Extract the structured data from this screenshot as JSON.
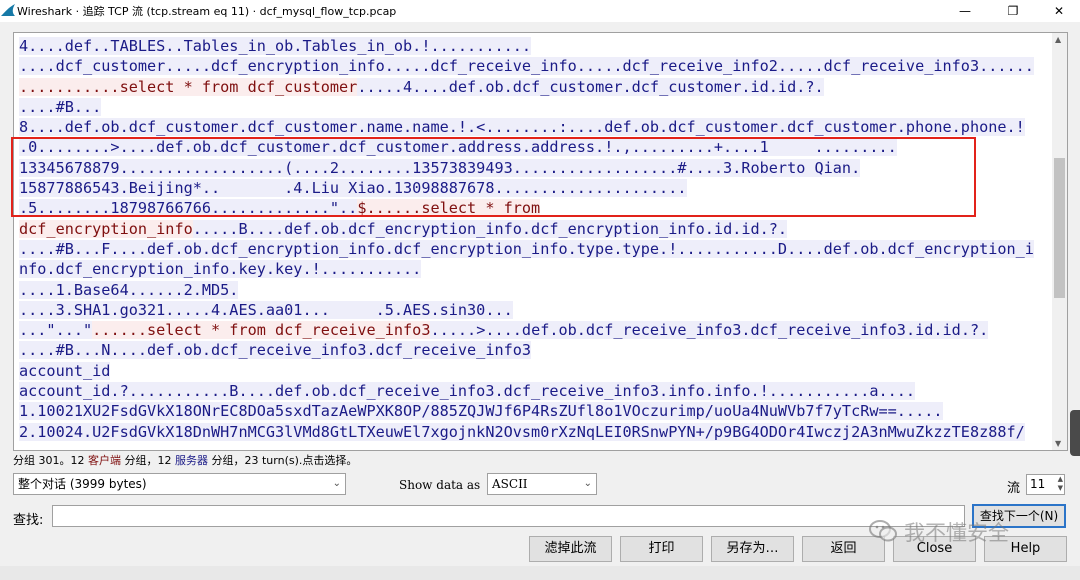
{
  "window": {
    "title": "Wireshark · 追踪 TCP 流 (tcp.stream eq 11) · dcf_mysql_flow_tcp.pcap",
    "controls": [
      "—",
      "❐",
      "✕"
    ]
  },
  "stream_lines": [
    [
      {
        "t": "4....def..TABLES..Tables_in_ob.Tables_in_ob.!...........",
        "k": "s"
      }
    ],
    [
      {
        "t": "....dcf_customer.....dcf_encryption_info.....dcf_receive_info.....dcf_receive_info2.....dcf_receive_info3......",
        "k": "s"
      }
    ],
    [
      {
        "t": "...........select * from dcf_customer",
        "k": "c"
      },
      {
        "t": ".....4....def.ob.dcf_customer.dcf_customer.id.id.?.",
        "k": "s"
      }
    ],
    [
      {
        "t": "....#B...",
        "k": "s"
      }
    ],
    [
      {
        "t": "8....def.ob.dcf_customer.dcf_customer.name.name.!.<........:....def.ob.dcf_customer.dcf_customer.phone.phone.!",
        "k": "s"
      }
    ],
    [
      {
        "t": ".0........>....def.ob.dcf_customer.dcf_customer.address.address.!.,.........+....1     .........",
        "k": "s"
      }
    ],
    [
      {
        "t": "13345678879..................(....2........13573839493..................#....3.Roberto Qian.",
        "k": "s"
      }
    ],
    [
      {
        "t": "15877886543.Beijing*..       .4.Liu Xiao.13098887678.....................",
        "k": "s"
      }
    ],
    [
      {
        "t": ".5........18798766766.............\"..",
        "k": "s"
      },
      {
        "t": "$......select * from",
        "k": "c"
      }
    ],
    [
      {
        "t": "dcf_encryption_info",
        "k": "c"
      },
      {
        "t": ".....B....def.ob.dcf_encryption_info.dcf_encryption_info.id.id.?.",
        "k": "s"
      }
    ],
    [
      {
        "t": "....#B...F....def.ob.dcf_encryption_info.dcf_encryption_info.type.type.!...........D....def.ob.dcf_encryption_i",
        "k": "s"
      }
    ],
    [
      {
        "t": "nfo.dcf_encryption_info.key.key.!...........",
        "k": "s"
      }
    ],
    [
      {
        "t": "....1.Base64......2.MD5.",
        "k": "s"
      }
    ],
    [
      {
        "t": "....3.SHA1.go321.....4.AES.aa01...     .5.AES.sin30...",
        "k": "s"
      }
    ],
    [
      {
        "t": "...\"...\"",
        "k": "s"
      },
      {
        "t": "......select * from dcf_receive_info3",
        "k": "c"
      },
      {
        "t": ".....>....def.ob.dcf_receive_info3.dcf_receive_info3.id.id.?.",
        "k": "s"
      }
    ],
    [
      {
        "t": "....#B...N....def.ob.dcf_receive_info3.dcf_receive_info3",
        "k": "s"
      }
    ],
    [
      {
        "t": "account_id",
        "k": "s"
      }
    ],
    [
      {
        "t": "account_id.?...........B....def.ob.dcf_receive_info3.dcf_receive_info3.info.info.!...........a....",
        "k": "s"
      }
    ],
    [
      {
        "t": "1.10021XU2FsdGVkX18ONrEC8DOa5sxdTazAeWPXK8OP/885ZQJWJf6P4RsZUfl8o1VOczurimp/uoUa4NuWVb7f7yTcRw==.....",
        "k": "s"
      }
    ],
    [
      {
        "t": "2.10024.U2FsdGVkX18DnWH7nMCG3lVMd8GtLTXeuwEl7xgojnkN2Ovsm0rXzNqLEI0RSnwPYN+/p9BG4ODOr4Iwczj2A3nMwuZkzzTE8z88f/",
        "k": "s"
      }
    ]
  ],
  "status": {
    "prefix": "分组 301。12 ",
    "client": "客户端",
    "middle": " 分组，12 ",
    "server": "服务器",
    "suffix": " 分组，23 turn(s).点击选择。"
  },
  "controls": {
    "conversation": "整个对话 (3999 bytes)",
    "show_data_label": "Show data as",
    "show_data_value": "ASCII",
    "stream_label": "流",
    "stream_value": "11",
    "find_label": "查找:",
    "find_value": "",
    "find_next": "查找下一个(N)"
  },
  "buttons": {
    "filter_out": "滤掉此流",
    "print": "打印",
    "save_as": "另存为…",
    "back": "返回",
    "close": "Close",
    "help": "Help"
  },
  "watermark": "我不懂安全",
  "colors": {
    "server_bg": "#eeeefa",
    "server_fg": "#1b1b87",
    "client_bg": "#fbeded",
    "client_fg": "#7f1010",
    "highlight_box": "#e2231a"
  }
}
